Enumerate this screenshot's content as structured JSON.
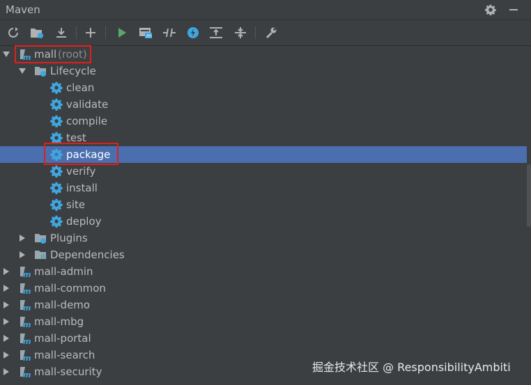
{
  "window": {
    "title": "Maven"
  },
  "titlebar_icons": [
    "gear-icon",
    "minimize-icon"
  ],
  "toolbar": {
    "icons": [
      "refresh-icon",
      "generate-sources-icon",
      "download-icon",
      "add-icon",
      "run-icon",
      "execute-goal-icon",
      "toggle-offline-icon",
      "skip-tests-icon",
      "show-dependencies-icon",
      "collapse-all-icon",
      "settings-wrench-icon"
    ]
  },
  "tree": {
    "root": {
      "name": "mall",
      "suffix": "(root)"
    },
    "lifecycle": {
      "label": "Lifecycle",
      "phases": [
        "clean",
        "validate",
        "compile",
        "test",
        "package",
        "verify",
        "install",
        "site",
        "deploy"
      ],
      "selected": "package"
    },
    "plugins": "Plugins",
    "dependencies": "Dependencies",
    "modules": [
      "mall-admin",
      "mall-common",
      "mall-demo",
      "mall-mbg",
      "mall-portal",
      "mall-search",
      "mall-security"
    ]
  },
  "colors": {
    "background": "#3c3f41",
    "selection": "#4b6eaf",
    "gear": "#3fa6e0",
    "highlight_box": "#e0201b",
    "run_green": "#59a869"
  },
  "watermark": "掘金技术社区 @ ResponsibilityAmbiti"
}
